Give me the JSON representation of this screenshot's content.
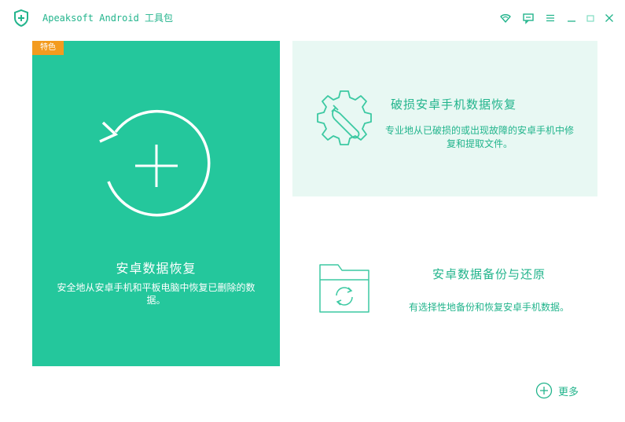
{
  "app": {
    "title": "Apeaksoft Android 工具包",
    "accent_color": "#22b48c",
    "card_color": "#24c79c",
    "badge_color": "#f39b1e"
  },
  "titlebar": {
    "icons": [
      "wifi-icon",
      "feedback-icon",
      "menu-icon",
      "minimize-icon",
      "maximize-icon",
      "close-icon"
    ]
  },
  "main_card": {
    "badge": "特色",
    "title": "安卓数据恢复",
    "description": "安全地从安卓手机和平板电脑中恢复已删除的数据。",
    "icon": "restore-plus-icon"
  },
  "broken_card": {
    "title": "破损安卓手机数据恢复",
    "description": "专业地从已破损的或出现故障的安卓手机中修复和提取文件。",
    "icon": "gear-wrench-icon"
  },
  "backup_card": {
    "title": "安卓数据备份与还原",
    "description": "有选择性地备份和恢复安卓手机数据。",
    "icon": "folder-sync-icon"
  },
  "more": {
    "label": "更多",
    "icon": "plus-circle-icon"
  }
}
